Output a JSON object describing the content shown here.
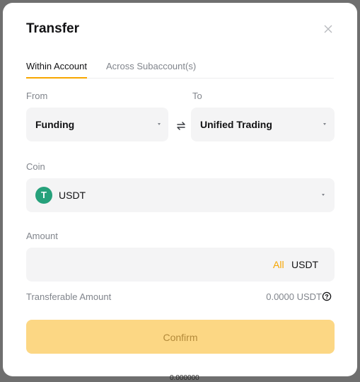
{
  "dialog": {
    "title": "Transfer",
    "close_icon": "close-icon"
  },
  "tabs": [
    {
      "label": "Within Account",
      "active": true
    },
    {
      "label": "Across Subaccount(s)",
      "active": false
    }
  ],
  "from": {
    "label": "From",
    "value": "Funding"
  },
  "to": {
    "label": "To",
    "value": "Unified Trading"
  },
  "swap_icon": "swap-arrows-icon",
  "coin": {
    "label": "Coin",
    "symbol_letter": "T",
    "value": "USDT",
    "icon_color": "#26a17b"
  },
  "amount": {
    "label": "Amount",
    "value": "",
    "placeholder": "",
    "all_label": "All",
    "unit": "USDT"
  },
  "transferable": {
    "label": "Transferable Amount",
    "value": "0.0000 USDT"
  },
  "confirm_label": "Confirm",
  "background_text": "0.000000",
  "colors": {
    "accent": "#f7a600",
    "confirm_bg": "#fcd784",
    "field_bg": "#f4f4f5",
    "muted_text": "#81858c"
  }
}
